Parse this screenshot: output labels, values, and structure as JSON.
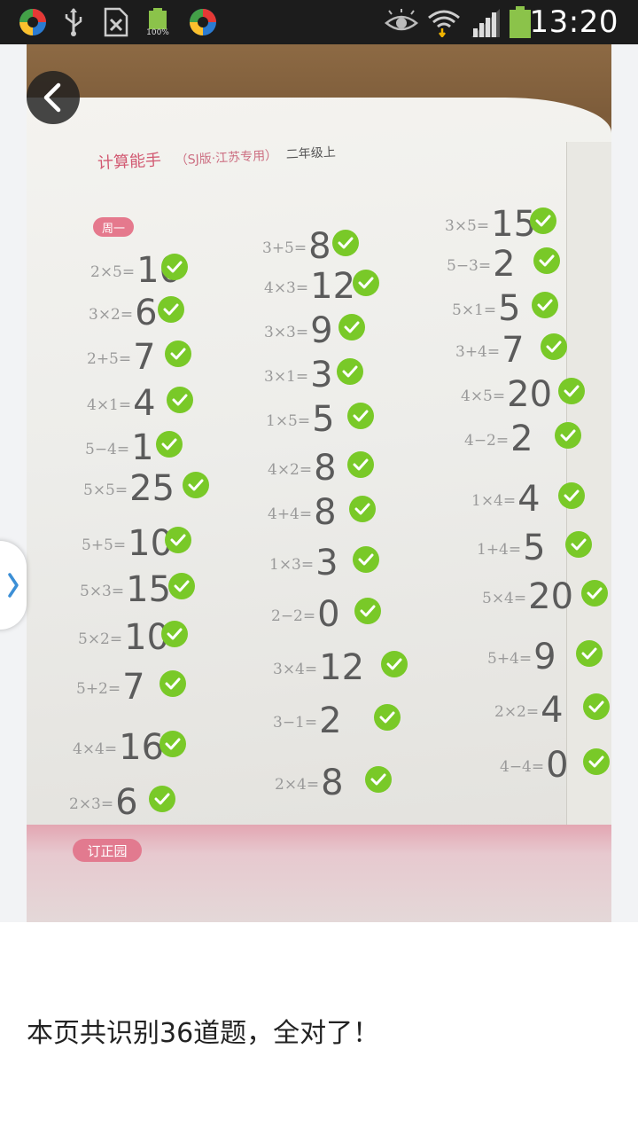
{
  "status_bar": {
    "time": "13:20",
    "battery_percent_label": "100%",
    "icons_left": [
      "app-logo-icon",
      "usb-icon",
      "sim-off-icon",
      "battery-full-icon",
      "app-logo-icon"
    ],
    "icons_right": [
      "eye-icon",
      "wifi-icon",
      "signal-icon",
      "battery-icon"
    ]
  },
  "photo": {
    "book_title": "计算能手",
    "book_subtitle": "（SJ版·江苏专用）",
    "book_grade": "二年级上",
    "week_tag": "周一",
    "bottom_tag": "订正园"
  },
  "columns": [
    {
      "equations": [
        {
          "q": "2×5=",
          "a": "10",
          "correct": true
        },
        {
          "q": "3×2=",
          "a": "6",
          "correct": true
        },
        {
          "q": "2+5=",
          "a": "7",
          "correct": true
        },
        {
          "q": "4×1=",
          "a": "4",
          "correct": true
        },
        {
          "q": "5−4=",
          "a": "1",
          "correct": true
        },
        {
          "q": "5×5=",
          "a": "25",
          "correct": true
        },
        {
          "q": "5+5=",
          "a": "10",
          "correct": true
        },
        {
          "q": "5×3=",
          "a": "15",
          "correct": true
        },
        {
          "q": "5×2=",
          "a": "10",
          "correct": true
        },
        {
          "q": "5+2=",
          "a": "7",
          "correct": true
        },
        {
          "q": "4×4=",
          "a": "16",
          "correct": true
        },
        {
          "q": "2×3=",
          "a": "6",
          "correct": true
        }
      ]
    },
    {
      "equations": [
        {
          "q": "3+5=",
          "a": "8",
          "correct": true
        },
        {
          "q": "4×3=",
          "a": "12",
          "correct": true
        },
        {
          "q": "3×3=",
          "a": "9",
          "correct": true
        },
        {
          "q": "3×1=",
          "a": "3",
          "correct": true
        },
        {
          "q": "1×5=",
          "a": "5",
          "correct": true
        },
        {
          "q": "4×2=",
          "a": "8",
          "correct": true
        },
        {
          "q": "4+4=",
          "a": "8",
          "correct": true
        },
        {
          "q": "1×3=",
          "a": "3",
          "correct": true
        },
        {
          "q": "2−2=",
          "a": "0",
          "correct": true
        },
        {
          "q": "3×4=",
          "a": "12",
          "correct": true
        },
        {
          "q": "3−1=",
          "a": "2",
          "correct": true
        },
        {
          "q": "2×4=",
          "a": "8",
          "correct": true
        }
      ]
    },
    {
      "equations": [
        {
          "q": "3×5=",
          "a": "15",
          "correct": true
        },
        {
          "q": "5−3=",
          "a": "2",
          "correct": true
        },
        {
          "q": "5×1=",
          "a": "5",
          "correct": true
        },
        {
          "q": "3+4=",
          "a": "7",
          "correct": true
        },
        {
          "q": "4×5=",
          "a": "20",
          "correct": true
        },
        {
          "q": "4−2=",
          "a": "2",
          "correct": true
        },
        {
          "q": "1×4=",
          "a": "4",
          "correct": true
        },
        {
          "q": "1+4=",
          "a": "5",
          "correct": true
        },
        {
          "q": "5×4=",
          "a": "20",
          "correct": true
        },
        {
          "q": "5+4=",
          "a": "9",
          "correct": true
        },
        {
          "q": "2×2=",
          "a": "4",
          "correct": true
        },
        {
          "q": "4−4=",
          "a": "0",
          "correct": true
        }
      ]
    }
  ],
  "controls": {
    "back_icon": "chevron-left-icon",
    "side_tab_icon": "chevron-right-icon"
  },
  "result": {
    "text": "本页共识别36道题，全对了！"
  },
  "colors": {
    "check_green": "#79c928",
    "status_bar_bg": "#1c1c1c",
    "tag_pink": "#e27a8f"
  }
}
